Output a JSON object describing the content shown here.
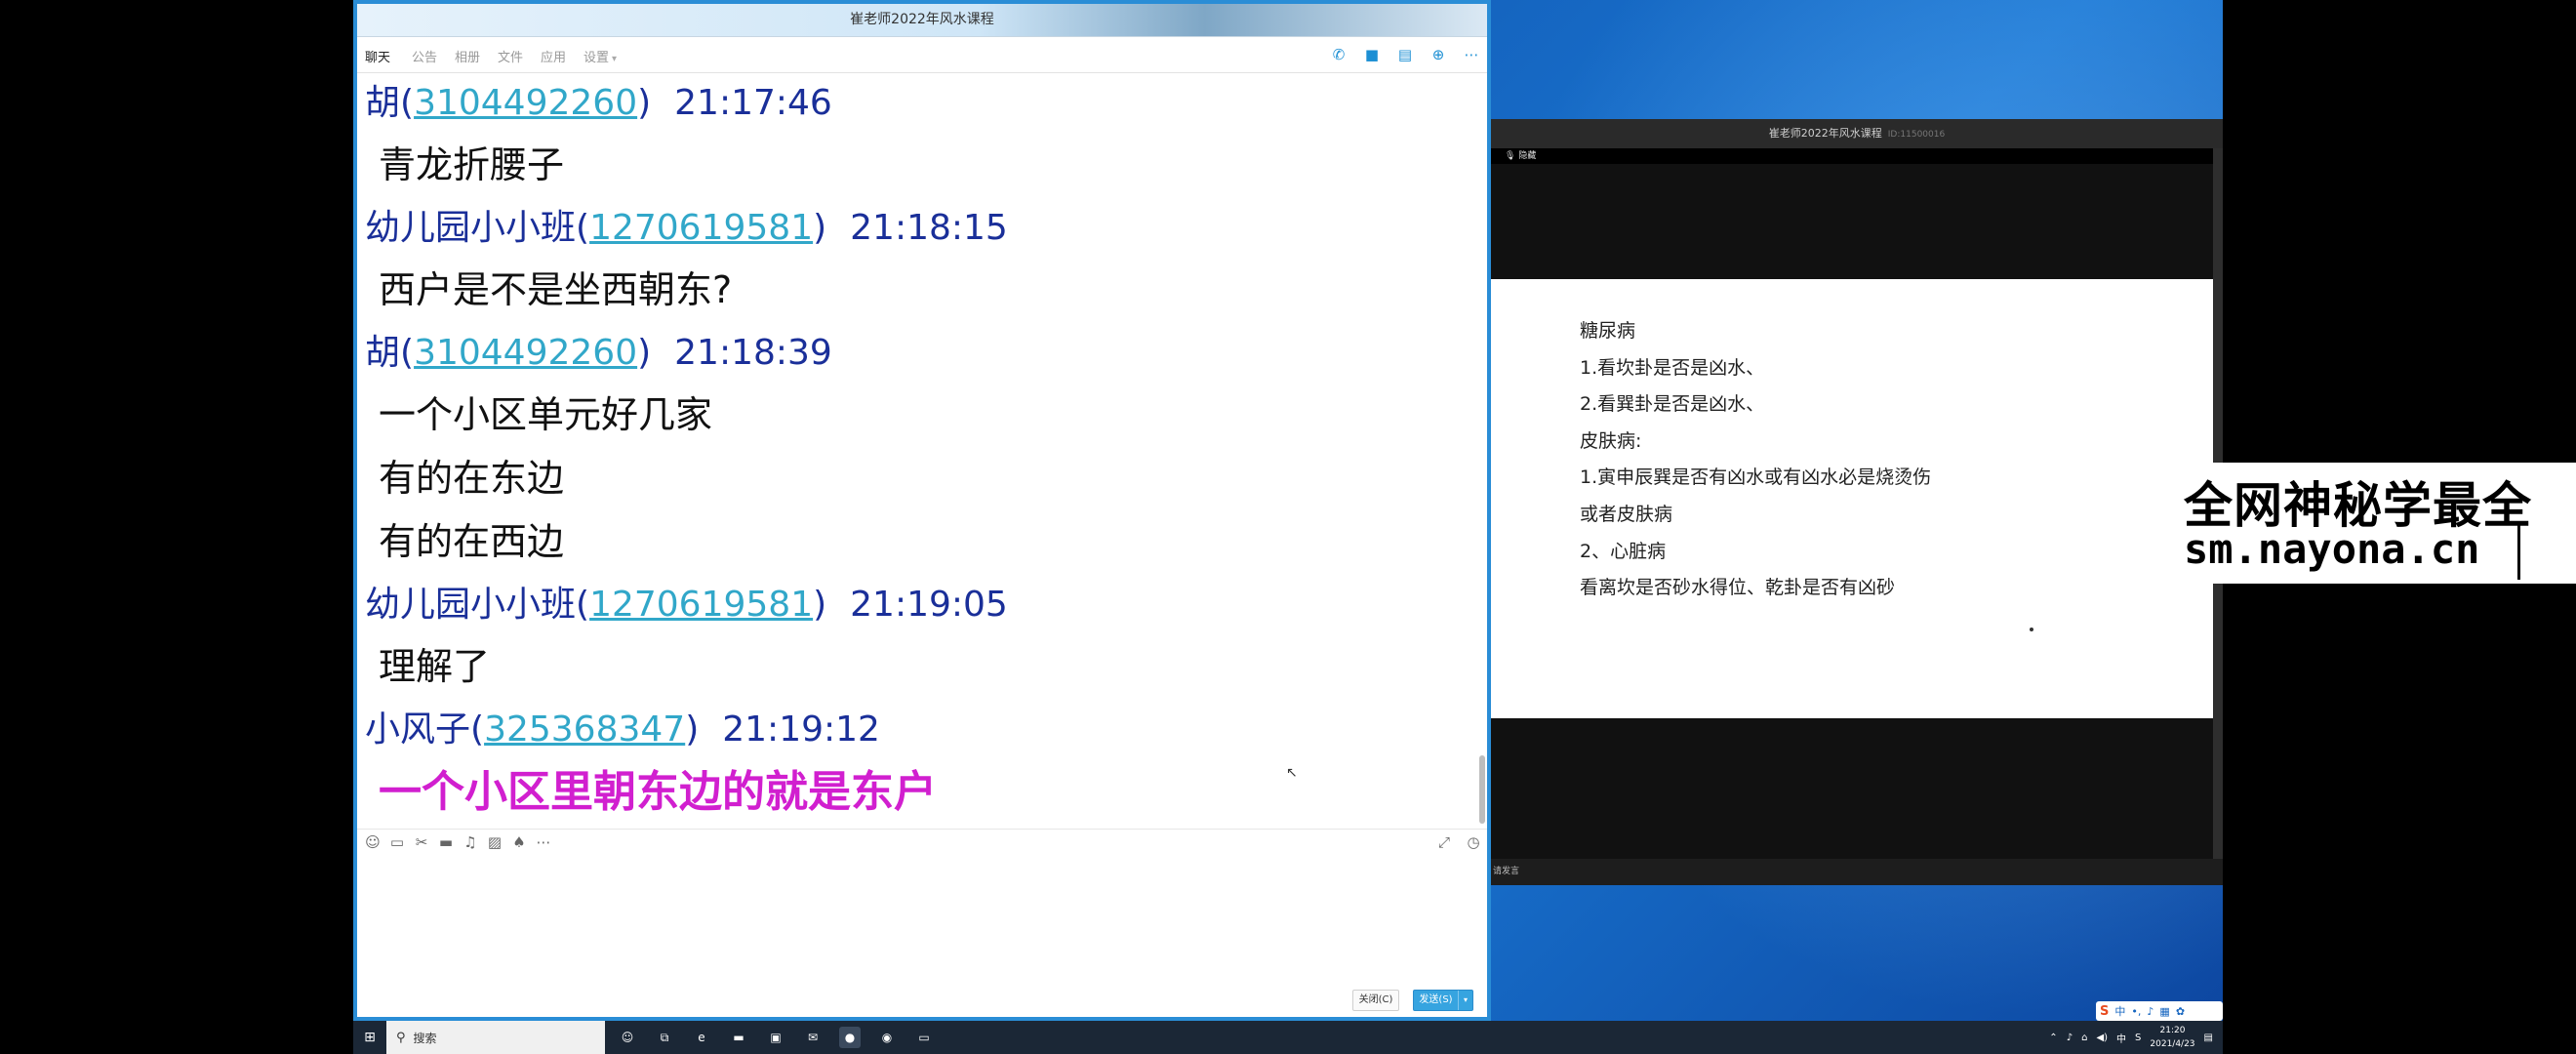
{
  "chat_window": {
    "title": "崔老师2022年风水课程",
    "tabs": [
      "聊天",
      "公告",
      "相册",
      "文件",
      "应用",
      "设置"
    ],
    "tools": [
      {
        "icon": "phone-icon",
        "glyph": "✆"
      },
      {
        "icon": "video-icon",
        "glyph": "■"
      },
      {
        "icon": "notes-icon",
        "glyph": "▤"
      },
      {
        "icon": "add-app-icon",
        "glyph": "⊕"
      },
      {
        "icon": "more-icon",
        "glyph": "⋯"
      }
    ],
    "messages": [
      {
        "sender": "胡",
        "qq": "3104492260",
        "time": "21:17:46",
        "lines": [
          "青龙折腰子"
        ],
        "emph": false
      },
      {
        "sender": "幼儿园小小班",
        "qq": "1270619581",
        "time": "21:18:15",
        "lines": [
          "西户是不是坐西朝东?"
        ],
        "emph": false
      },
      {
        "sender": "胡",
        "qq": "3104492260",
        "time": "21:18:39",
        "lines": [
          "一个小区单元好几家",
          "有的在东边",
          "有的在西边"
        ],
        "emph": false
      },
      {
        "sender": "幼儿园小小班",
        "qq": "1270619581",
        "time": "21:19:05",
        "lines": [
          "理解了"
        ],
        "emph": false
      },
      {
        "sender": "小风子",
        "qq": "325368347",
        "time": "21:19:12",
        "lines": [
          "一个小区里朝东边的就是东户"
        ],
        "emph": true
      }
    ],
    "input_toolbar": {
      "left_icons": [
        {
          "icon": "emoji-icon",
          "glyph": "☺"
        },
        {
          "icon": "gif-icon",
          "glyph": "▭"
        },
        {
          "icon": "screenshot-icon",
          "glyph": "✂"
        },
        {
          "icon": "folder-icon",
          "glyph": "▬"
        },
        {
          "icon": "voice-icon",
          "glyph": "♫"
        },
        {
          "icon": "image-icon",
          "glyph": "▨"
        },
        {
          "icon": "shake-icon",
          "glyph": "♠"
        },
        {
          "icon": "more-tools-icon",
          "glyph": "⋯"
        }
      ],
      "right_icons": [
        {
          "icon": "expand-icon",
          "glyph": "⤢"
        },
        {
          "icon": "history-icon",
          "glyph": "◷"
        }
      ]
    },
    "close_label": "关闭(C)",
    "send_label": "发送(S)"
  },
  "class_window": {
    "title": "崔老师2022年风水课程",
    "room_id": "ID:11500016",
    "bar_label": "隐藏",
    "bottom_label": "请发言",
    "slide_lines": [
      "糖尿病",
      "1.看坎卦是否是凶水、",
      "2.看巽卦是否是凶水、",
      "皮肤病:",
      "1.寅申辰巽是否有凶水或有凶水必是烧烫伤",
      "或者皮肤病",
      "2、心脏病",
      "看离坎是否砂水得位、乾卦是否有凶砂"
    ]
  },
  "watermark": {
    "line1": "全网神秘学最全",
    "line2": "sm.nayona.cn"
  },
  "taskbar": {
    "search_placeholder": "搜索",
    "apps": [
      {
        "icon": "person-icon",
        "glyph": "☺"
      },
      {
        "icon": "task-view-icon",
        "glyph": "⧉"
      },
      {
        "icon": "edge-icon",
        "glyph": "e"
      },
      {
        "icon": "explorer-icon",
        "glyph": "▬"
      },
      {
        "icon": "store-icon",
        "glyph": "▣"
      },
      {
        "icon": "mail-icon",
        "glyph": "✉"
      },
      {
        "icon": "qq-icon",
        "glyph": "●"
      },
      {
        "icon": "chrome-icon",
        "glyph": "◉"
      },
      {
        "icon": "screen-icon",
        "glyph": "▭"
      }
    ],
    "tray_text": "中",
    "clock_time": "21:20",
    "clock_date": "2021/4/23",
    "ime_logo": "S",
    "ime_lang": "中"
  },
  "colors": {
    "sender": "#1a2f99",
    "qq_link": "#31a7c9",
    "emphasis": "#d11fcf",
    "window_border": "#2a8dd6"
  }
}
